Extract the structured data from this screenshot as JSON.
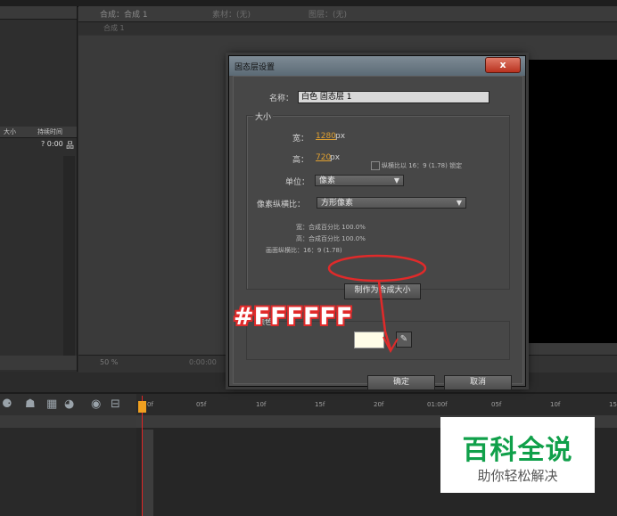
{
  "dialog": {
    "title": "固态层设置",
    "close": "x",
    "name_label": "名称：",
    "name_value": "白色 固态层 1",
    "size_section": "大小",
    "width_label": "宽：",
    "width_value": "1280",
    "height_label": "高：",
    "height_value": "720",
    "px_unit": "px",
    "lock_label": "纵横比以 16：9 (1.78) 锁定",
    "units_label": "单位：",
    "units_value": "像素",
    "pixel_aspect_label": "像素纵横比：",
    "pixel_aspect_value": "方形像素",
    "info_width": "宽：合成百分比 100.0%",
    "info_height": "高：合成百分比 100.0%",
    "info_frame": "画面纵横比：16：9 (1.78)",
    "make_comp_size": "制作为合成大小",
    "color_section": "颜色",
    "color_value": "#FFFDE8",
    "ok": "确定",
    "cancel": "取消"
  },
  "annotation": {
    "hex": "#FFFFFF",
    "color": "#E02A2A"
  },
  "comp_panel": {
    "tabs": [
      "合成：合成 1",
      "素材：(无)",
      "图层：(无)"
    ],
    "sub_tab": "合成 1",
    "zoom": "50 %",
    "timecode": "0:00:00"
  },
  "project_panel": {
    "col_size": "大小",
    "col_duration": "持续时间",
    "row_duration": "? 0:00"
  },
  "timeline": {
    "ticks": [
      "0f",
      "05f",
      "10f",
      "15f",
      "20f",
      "01:00f",
      "05f",
      "10f",
      "15"
    ]
  },
  "watermark": {
    "title": "百科全说",
    "subtitle": "助你轻松解决",
    "color": "#10A04A"
  }
}
